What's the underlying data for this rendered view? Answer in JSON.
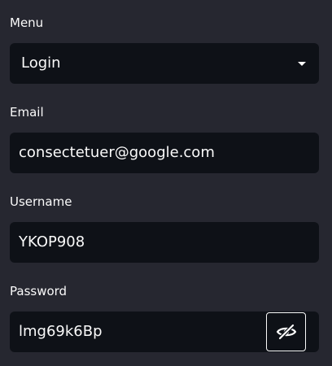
{
  "form": {
    "menu": {
      "label": "Menu",
      "value": "Login",
      "icon": "chevron-down-icon"
    },
    "email": {
      "label": "Email",
      "value": "consectetuer@google.com"
    },
    "username": {
      "label": "Username",
      "value": "YKOP908"
    },
    "password": {
      "label": "Password",
      "value": "lmg69k6Bp",
      "toggle_icon": "eye-off-icon"
    }
  }
}
